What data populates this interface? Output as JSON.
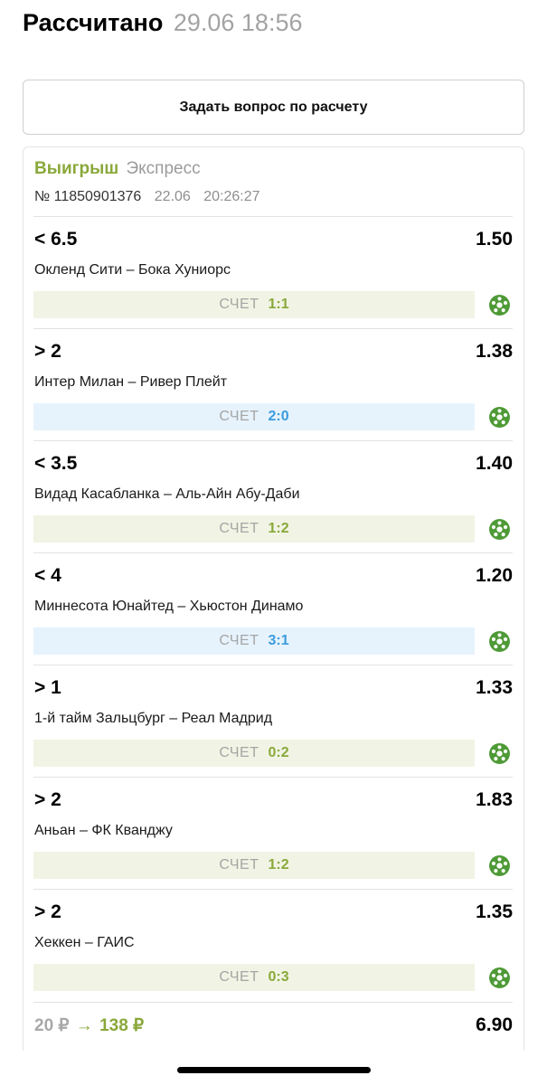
{
  "header": {
    "title": "Рассчитано",
    "datetime": "29.06 18:56"
  },
  "ask_button": {
    "label": "Задать вопрос по расчету"
  },
  "bet": {
    "status": "Выигрыш",
    "type": "Экспресс",
    "number": "№ 11850901376",
    "date": "22.06",
    "time": "20:26:27"
  },
  "score_label": "СЧЕТ",
  "colors": {
    "win_green": "#8aa83a",
    "score_blue": "#3b9cdf",
    "score_bg_green": "#f1f4e4",
    "score_bg_blue": "#e6f3fd"
  },
  "events": [
    {
      "line": "< 6.5",
      "odds": "1.50",
      "match": "Окленд Сити – Бока Хуниорс",
      "score": "1:1",
      "score_style": "green",
      "icon": "soccer-ball-icon"
    },
    {
      "line": "> 2",
      "odds": "1.38",
      "match": "Интер Милан – Ривер Плейт",
      "score": "2:0",
      "score_style": "blue",
      "icon": "soccer-ball-icon"
    },
    {
      "line": "< 3.5",
      "odds": "1.40",
      "match": "Видад Касабланка – Аль-Айн Абу-Даби",
      "score": "1:2",
      "score_style": "green",
      "icon": "soccer-ball-icon"
    },
    {
      "line": "< 4",
      "odds": "1.20",
      "match": "Миннесота Юнайтед – Хьюстон Динамо",
      "score": "3:1",
      "score_style": "blue",
      "icon": "soccer-ball-icon"
    },
    {
      "line": "> 1",
      "odds": "1.33",
      "match": "1-й тайм Зальцбург – Реал Мадрид",
      "score": "0:2",
      "score_style": "green",
      "icon": "soccer-ball-icon"
    },
    {
      "line": "> 2",
      "odds": "1.83",
      "match": "Аньан – ФК Кванджу",
      "score": "1:2",
      "score_style": "green",
      "icon": "soccer-ball-icon"
    },
    {
      "line": "> 2",
      "odds": "1.35",
      "match": "Хеккен – ГАИС",
      "score": "0:3",
      "score_style": "green",
      "icon": "soccer-ball-icon"
    }
  ],
  "footer": {
    "stake": "20 ₽",
    "arrow": "→",
    "payout": "138 ₽",
    "total_odds": "6.90"
  }
}
